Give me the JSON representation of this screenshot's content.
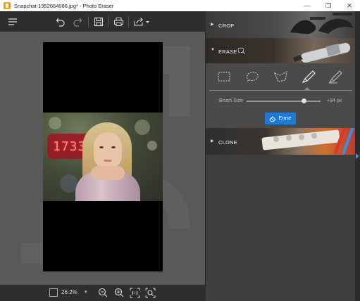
{
  "window": {
    "title": "Snapchat-1952664086.jpg* - Photo Eraser",
    "min_glyph": "—",
    "max_glyph": "❐",
    "close_glyph": "✕"
  },
  "toolbar": {
    "icons": [
      "menu-icon",
      "undo-icon",
      "redo-icon",
      "save-icon",
      "print-icon",
      "share-icon"
    ]
  },
  "canvas": {
    "photo_overlay_text": "1733"
  },
  "status": {
    "zoom": "26.2%",
    "zoom_caret": "▾",
    "icons": [
      "zoom-out-icon",
      "zoom-in-icon",
      "actual-size-icon",
      "fit-screen-icon"
    ]
  },
  "panel": {
    "crop_label": "CROP",
    "erase_label": "ERASE",
    "clone_label": "CLONE",
    "collapsed_arrow": "▶",
    "expanded_arrow": "▼",
    "brush_size_label": "Brush Size",
    "brush_size_value": "+94 px",
    "brush_size_fraction": 0.77,
    "erase_button": "Erase",
    "tools": [
      "rectangle-select-icon",
      "lasso-icon",
      "polygon-lasso-icon",
      "brush-icon",
      "eraser-brush-icon"
    ],
    "active_tool": "brush-icon"
  },
  "colors": {
    "accent": "#1e7ad6",
    "panel_bg": "#3e3e3e",
    "canvas_bg": "#595959"
  }
}
